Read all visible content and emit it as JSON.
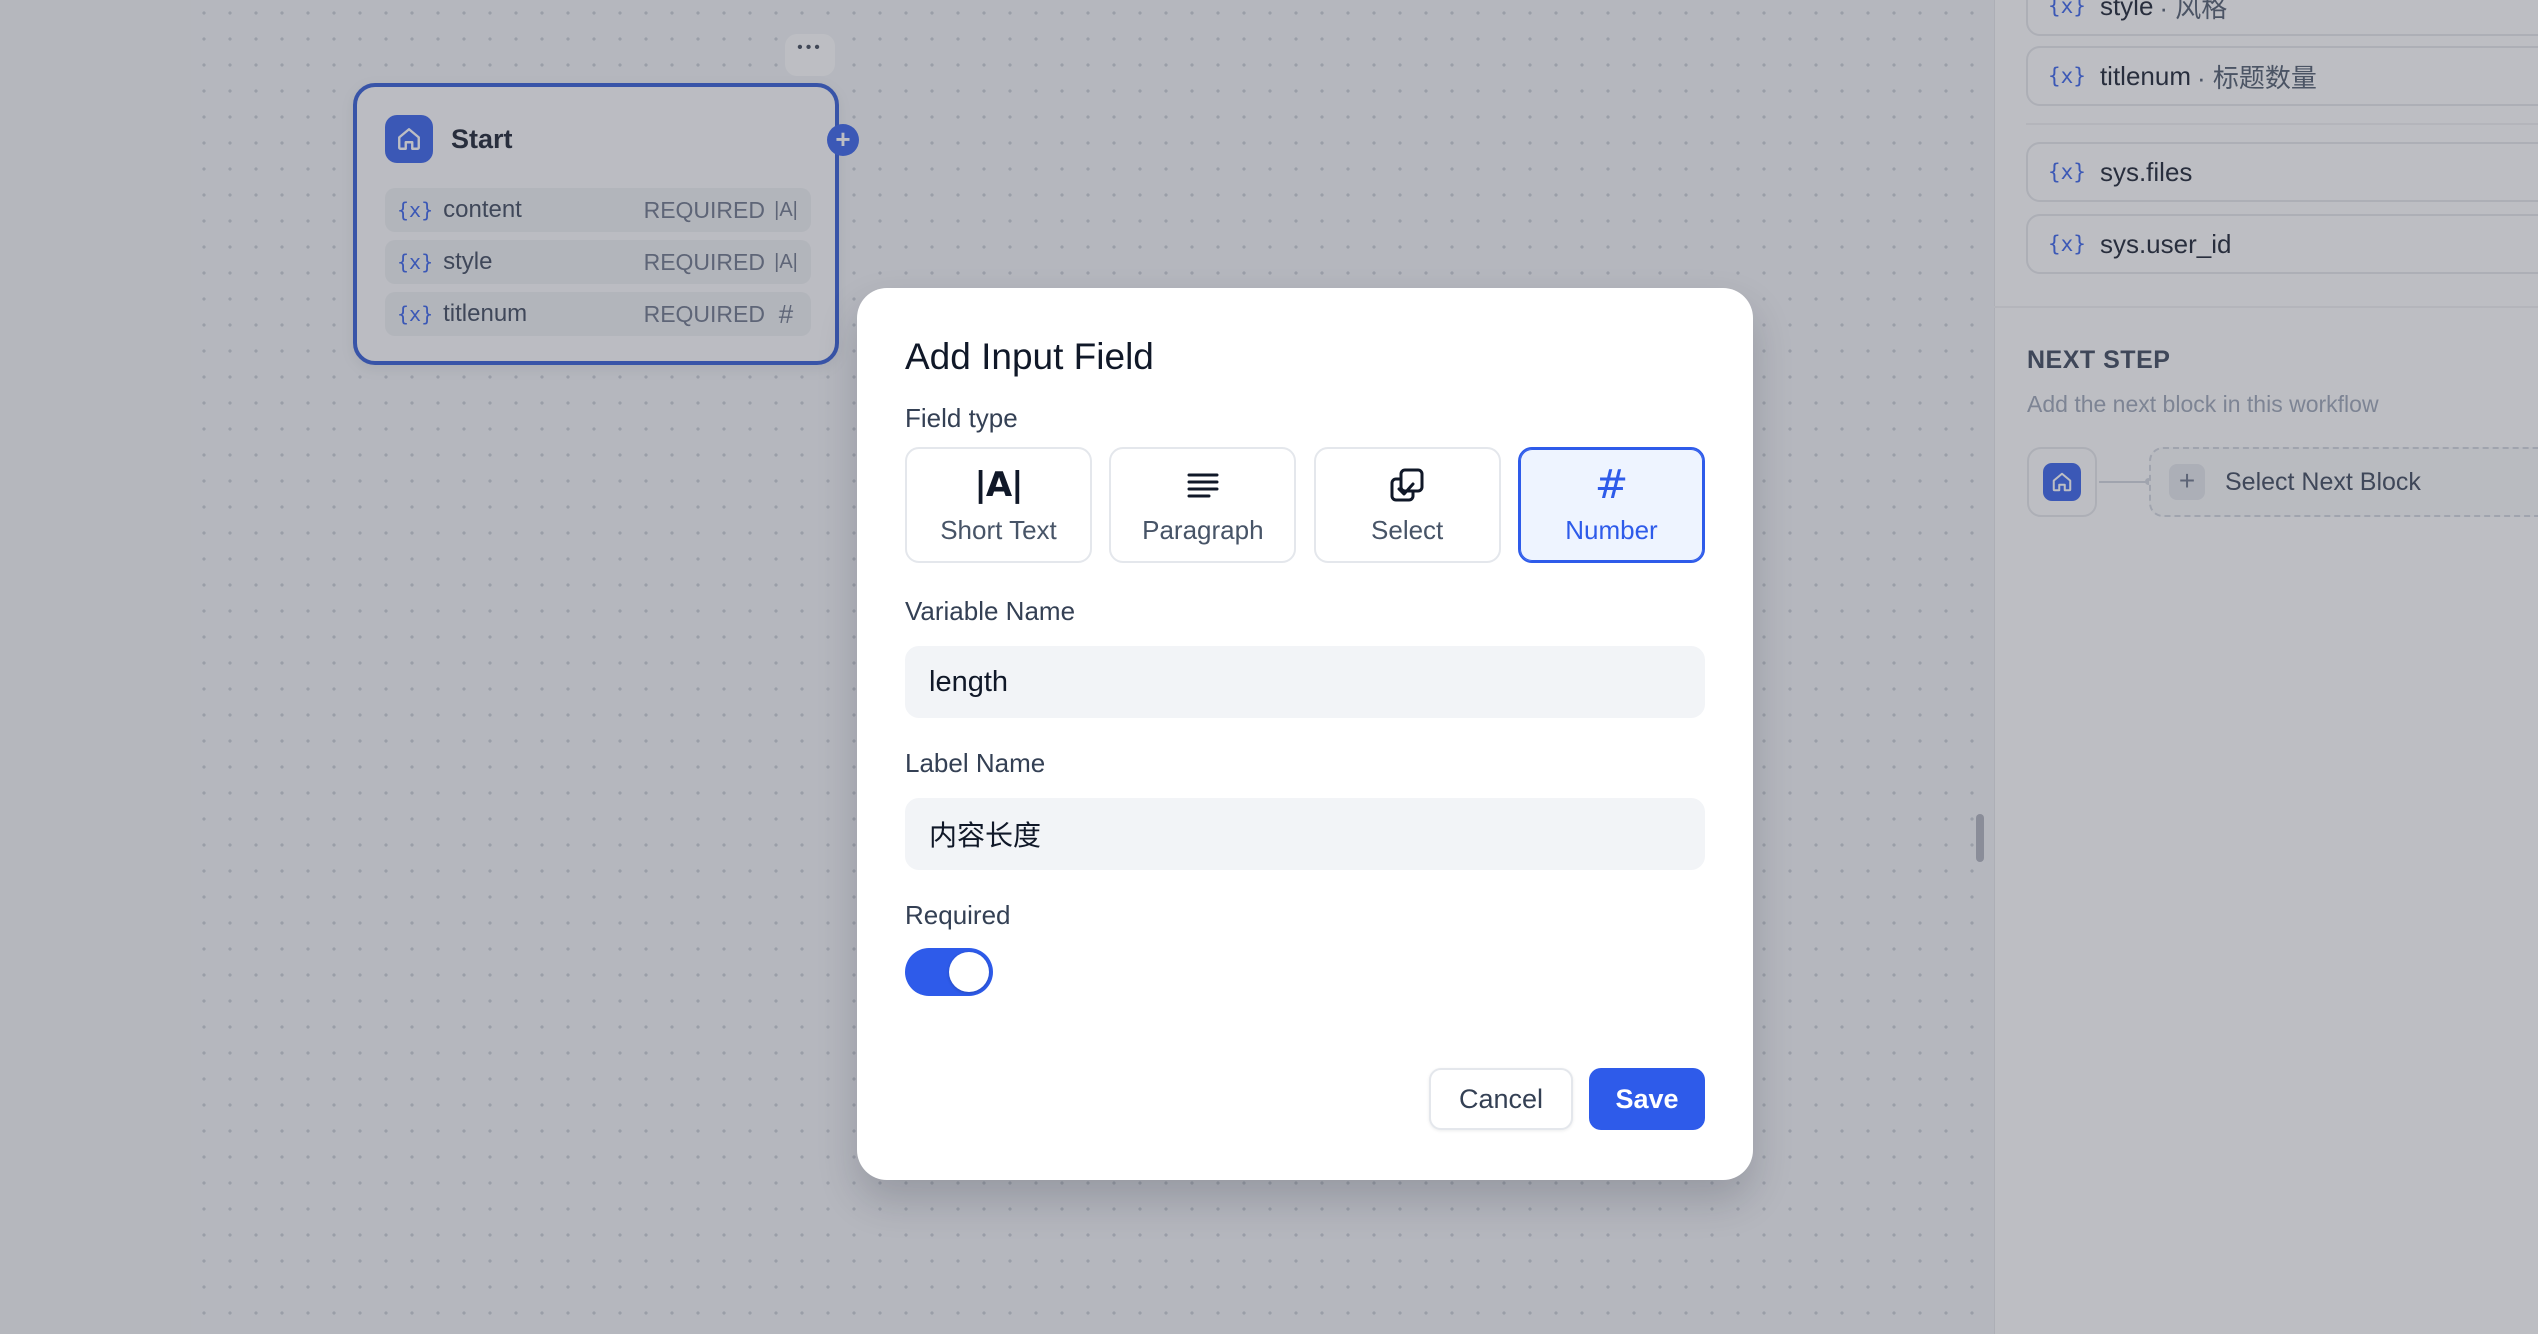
{
  "start_node": {
    "title": "Start",
    "more_glyph": "•••",
    "add_glyph": "+",
    "variables": [
      {
        "tag": "{x}",
        "name": "content",
        "required": "REQUIRED",
        "type_glyph": "|A|"
      },
      {
        "tag": "{x}",
        "name": "style",
        "required": "REQUIRED",
        "type_glyph": "|A|"
      },
      {
        "tag": "{x}",
        "name": "titlenum",
        "required": "REQUIRED",
        "type_glyph": "#"
      }
    ]
  },
  "right_panel": {
    "variables": [
      {
        "tag": "{x}",
        "name": "style",
        "label": "· 风格"
      },
      {
        "tag": "{x}",
        "name": "titlenum",
        "label": "· 标题数量"
      },
      {
        "tag": "{x}",
        "name": "sys.files",
        "label": ""
      },
      {
        "tag": "{x}",
        "name": "sys.user_id",
        "label": ""
      }
    ],
    "next_step": {
      "title": "NEXT STEP",
      "description": "Add the next block in this workflow",
      "plus_glyph": "+",
      "select_label": "Select Next Block"
    }
  },
  "modal": {
    "title": "Add Input Field",
    "field_type_label": "Field type",
    "field_types": [
      {
        "label": "Short Text",
        "icon": "short-text-icon",
        "selected": false
      },
      {
        "label": "Paragraph",
        "icon": "paragraph-icon",
        "selected": false
      },
      {
        "label": "Select",
        "icon": "select-icon",
        "selected": false
      },
      {
        "label": "Number",
        "icon": "number-icon",
        "selected": true
      }
    ],
    "short_text_glyph": "|A|",
    "number_glyph": "#",
    "variable_name_label": "Variable Name",
    "variable_name_value": "length",
    "label_name_label": "Label Name",
    "label_name_value": "内容长度",
    "required_label": "Required",
    "required_on": true,
    "cancel_label": "Cancel",
    "save_label": "Save"
  },
  "colors": {
    "accent": "#2e5bea",
    "selected_bg": "#eef4ff",
    "overlay": "rgba(82,85,98,0.38)"
  }
}
